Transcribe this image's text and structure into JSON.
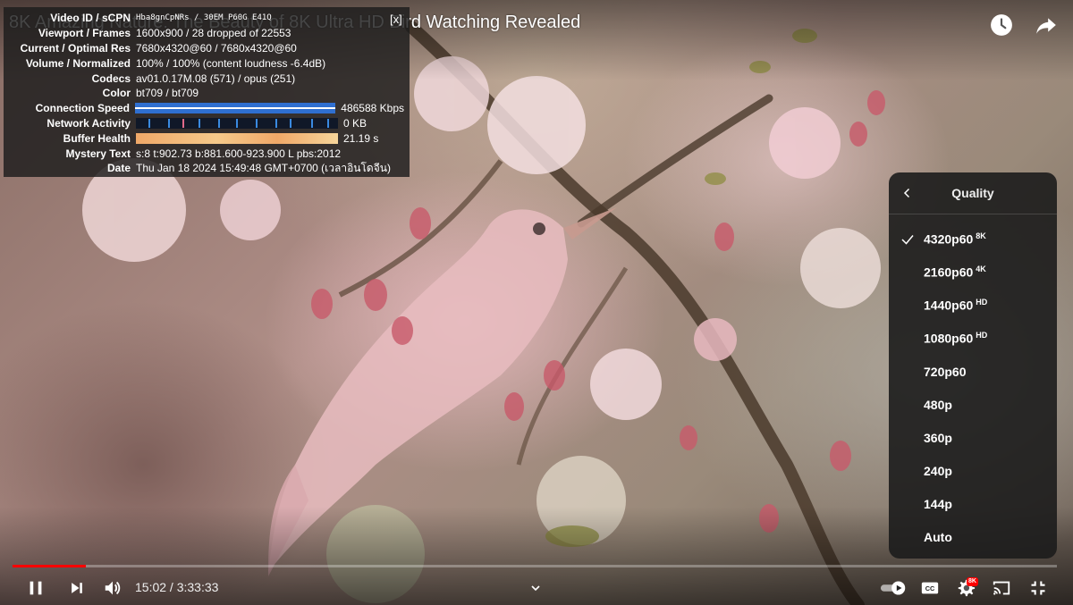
{
  "video": {
    "title": "8K Amazing Nature: The Beauty of 8K Ultra HD Bird Watching Revealed"
  },
  "stats": {
    "close_label": "[x]",
    "rows": [
      {
        "label": "Video ID / sCPN",
        "value": "Hba8gnCpNRs / 30EM P60G E41Q"
      },
      {
        "label": "Viewport / Frames",
        "value": "1600x900 / 28 dropped of 22553"
      },
      {
        "label": "Current / Optimal Res",
        "value": "7680x4320@60 / 7680x4320@60"
      },
      {
        "label": "Volume / Normalized",
        "value": "100% / 100% (content loudness -6.4dB)"
      },
      {
        "label": "Codecs",
        "value": "av01.0.17M.08 (571) / opus (251)"
      },
      {
        "label": "Color",
        "value": "bt709 / bt709"
      },
      {
        "label": "Connection Speed",
        "value": "486588 Kbps"
      },
      {
        "label": "Network Activity",
        "value": "0 KB"
      },
      {
        "label": "Buffer Health",
        "value": "21.19 s"
      },
      {
        "label": "Mystery Text",
        "value": "s:8 t:902.73 b:881.600-923.900 L pbs:2012"
      },
      {
        "label": "Date",
        "value": "Thu Jan 18 2024 15:49:48 GMT+0700 (เวลาอินโดจีน)"
      }
    ],
    "colors": {
      "speed": "#2f6fd0",
      "network": "#3a8ae0",
      "buffer": "#f0a868"
    }
  },
  "quality_menu": {
    "title": "Quality",
    "back_icon": "chevron-left-icon",
    "options": [
      {
        "label": "4320p60",
        "badge": "8K",
        "selected": true
      },
      {
        "label": "2160p60",
        "badge": "4K",
        "selected": false
      },
      {
        "label": "1440p60",
        "badge": "HD",
        "selected": false
      },
      {
        "label": "1080p60",
        "badge": "HD",
        "selected": false
      },
      {
        "label": "720p60",
        "badge": "",
        "selected": false
      },
      {
        "label": "480p",
        "badge": "",
        "selected": false
      },
      {
        "label": "360p",
        "badge": "",
        "selected": false
      },
      {
        "label": "240p",
        "badge": "",
        "selected": false
      },
      {
        "label": "144p",
        "badge": "",
        "selected": false
      },
      {
        "label": "Auto",
        "badge": "",
        "selected": false
      }
    ]
  },
  "player": {
    "current_time": "15:02",
    "duration": "3:33:33",
    "time_display": "15:02 / 3:33:33",
    "played_fraction": 0.07,
    "loaded_fraction": 0.07,
    "settings_badge": "8K",
    "accent_color": "#ff0000"
  },
  "icons": {
    "watch_later": "clock-icon",
    "share": "share-arrow-icon",
    "pause": "pause-icon",
    "next": "next-track-icon",
    "volume": "volume-icon",
    "chapters": "chevron-down-icon",
    "autoplay": "autoplay-toggle-icon",
    "subtitles": "cc-icon",
    "settings": "gear-icon",
    "cast": "cast-icon",
    "fullscreen": "exit-fullscreen-icon"
  }
}
